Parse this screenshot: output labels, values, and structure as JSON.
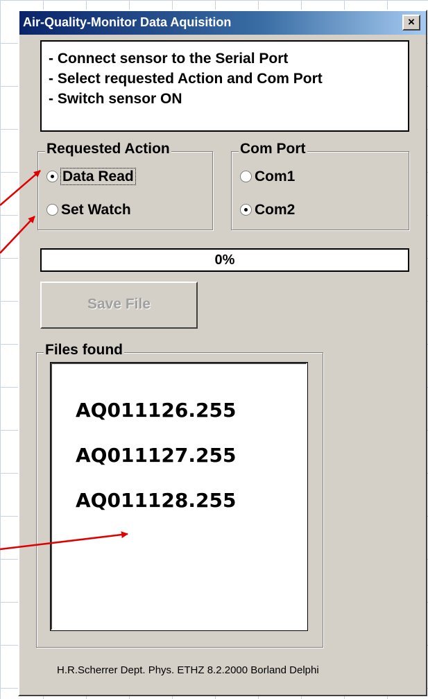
{
  "window": {
    "title": "Air-Quality-Monitor Data Aquisition",
    "close_label": "×"
  },
  "instructions": [
    "- Connect sensor to the Serial Port",
    "- Select requested Action and Com Port",
    "- Switch sensor ON"
  ],
  "requested_action": {
    "label": "Requested Action",
    "options": [
      {
        "label": "Data Read",
        "selected": true
      },
      {
        "label": "Set Watch",
        "selected": false
      }
    ]
  },
  "com_port": {
    "label": "Com Port",
    "options": [
      {
        "label": "Com1",
        "selected": false
      },
      {
        "label": "Com2",
        "selected": true
      }
    ]
  },
  "progress": {
    "text": "0%",
    "value": 0
  },
  "save_button": {
    "label": "Save File",
    "enabled": false
  },
  "files_found": {
    "label": "Files found",
    "items": [
      "AQ011126.255",
      "AQ011127.255",
      "AQ011128.255"
    ]
  },
  "footer": "H.R.Scherrer Dept. Phys. ETHZ 8.2.2000  Borland Delphi",
  "colors": {
    "window_bg": "#d4d0c8",
    "titlebar_start": "#0a246a",
    "titlebar_end": "#a6caf0",
    "annotation_arrow": "#e00000"
  }
}
